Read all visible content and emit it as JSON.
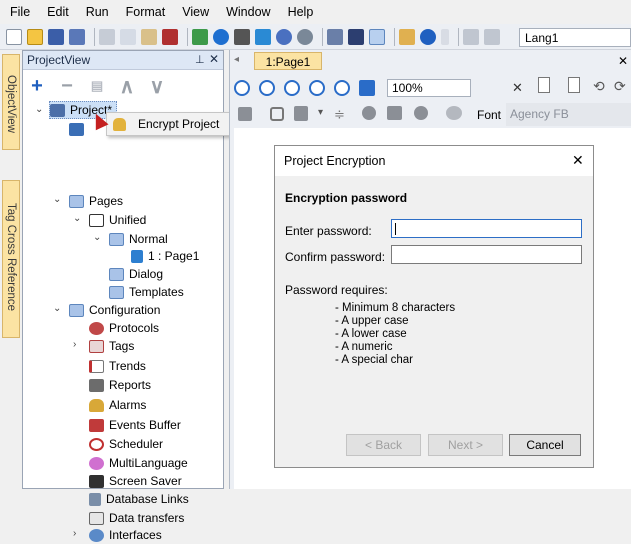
{
  "menu": [
    "File",
    "Edit",
    "Run",
    "Format",
    "View",
    "Window",
    "Help"
  ],
  "toolbar": {
    "language": "Lang1"
  },
  "side_tabs": {
    "object_view": "ObjectView",
    "tag_xref": "Tag Cross Reference"
  },
  "project_view": {
    "title": "ProjectView",
    "tools": {
      "add": "+",
      "remove": "−",
      "up": "∧",
      "down": "∨"
    },
    "items": [
      {
        "label": "Project*"
      },
      {
        "label": ""
      },
      {
        "label": "Pages"
      },
      {
        "label": "Unified"
      },
      {
        "label": "Normal"
      },
      {
        "label": "1 : Page1"
      },
      {
        "label": "Dialog"
      },
      {
        "label": "Templates"
      },
      {
        "label": "Configuration"
      },
      {
        "label": "Protocols"
      },
      {
        "label": "Tags"
      },
      {
        "label": "Trends"
      },
      {
        "label": "Reports"
      },
      {
        "label": "Alarms"
      },
      {
        "label": "Events Buffer"
      },
      {
        "label": "Scheduler"
      },
      {
        "label": "MultiLanguage"
      },
      {
        "label": "Screen Saver"
      },
      {
        "label": "Database Links"
      },
      {
        "label": "Data transfers"
      },
      {
        "label": "Interfaces"
      }
    ]
  },
  "context_menu": {
    "item": "Encrypt Project"
  },
  "editor": {
    "tab": "1:Page1",
    "zoom": "100%",
    "font_label": "Font",
    "font_value": "Agency FB"
  },
  "dialog": {
    "title": "Project Encryption",
    "heading": "Encryption password",
    "enter_label": "Enter password:",
    "confirm_label": "Confirm password:",
    "enter_value": "",
    "confirm_value": "",
    "requires_label": "Password requires:",
    "requirements": [
      "- Minimum 8 characters",
      "- A upper case",
      "- A lower case",
      "- A numeric",
      "- A special char"
    ],
    "back": "< Back",
    "next": "Next >",
    "cancel": "Cancel",
    "close": "✕"
  },
  "colors": {
    "accent": "#1f5fbf",
    "tab_yellow": "#fbe3a3"
  }
}
